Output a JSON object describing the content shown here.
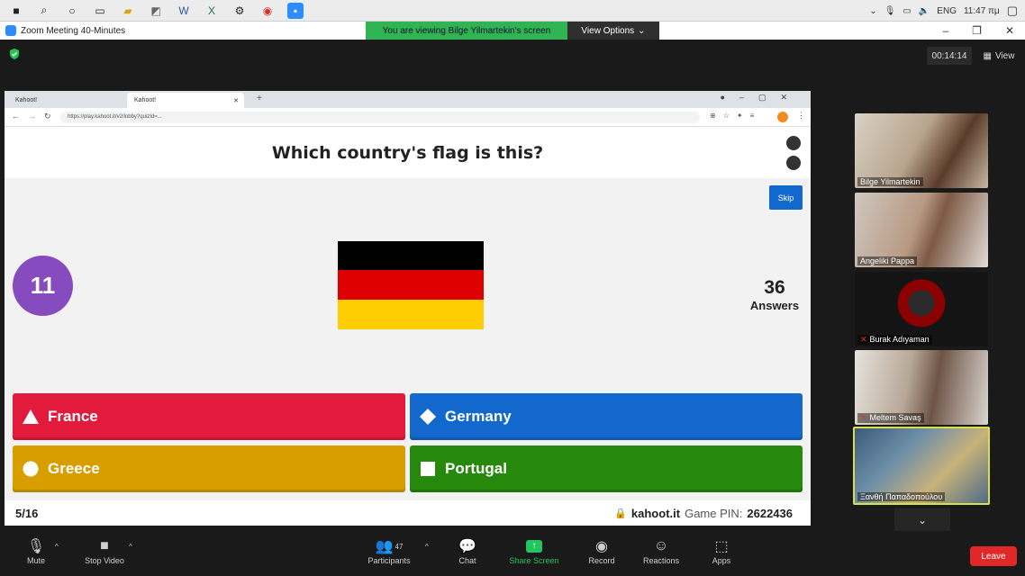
{
  "system_tray": {
    "lang": "ENG",
    "time": "11:47 πμ"
  },
  "zoom": {
    "window_title": "Zoom Meeting 40-Minutes",
    "share_banner": "You are viewing Bilge Yilmartekin's screen",
    "view_options": "View Options",
    "timer": "00:14:14",
    "view_label": "View"
  },
  "browser": {
    "tabs": [
      "Kahoot!",
      "Kahoot!"
    ],
    "url": "https://play.kahoot.it/v2/lobby?quizId=..."
  },
  "kahoot": {
    "question": "Which country's flag is this?",
    "skip_label": "Skip",
    "countdown": "11",
    "answers_count": "36",
    "answers_label": "Answers",
    "flag_colors": [
      "#000000",
      "#dd0000",
      "#ffce00"
    ],
    "options": [
      {
        "label": "France",
        "shape": "triangle",
        "color": "#e21b3c"
      },
      {
        "label": "Germany",
        "shape": "diamond",
        "color": "#1368ce"
      },
      {
        "label": "Greece",
        "shape": "circle",
        "color": "#d89e00"
      },
      {
        "label": "Portugal",
        "shape": "square",
        "color": "#26890c"
      }
    ],
    "progress": "5/16",
    "site": "kahoot.it",
    "pin_label": "Game PIN:",
    "pin": "2622436"
  },
  "participants": [
    {
      "name": "Bilge Yilmartekin",
      "muted": false
    },
    {
      "name": "Angeliki Pappa",
      "muted": false
    },
    {
      "name": "Burak Adıyaman",
      "muted": true
    },
    {
      "name": "Meltem Savaş",
      "muted": true
    },
    {
      "name": "Ξανθή Παπαδοπούλου",
      "muted": false
    }
  ],
  "toolbar": {
    "mute": "Mute",
    "stop_video": "Stop Video",
    "participants": "Participants",
    "participants_count": "47",
    "chat": "Chat",
    "share_screen": "Share Screen",
    "record": "Record",
    "reactions": "Reactions",
    "apps": "Apps",
    "leave": "Leave"
  }
}
